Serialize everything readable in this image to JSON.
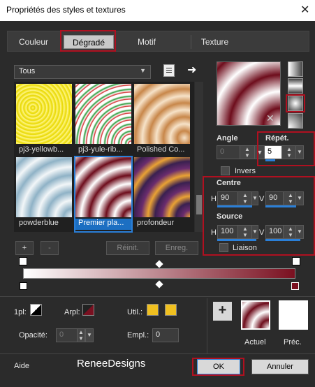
{
  "window": {
    "title": "Propriétés des styles et textures",
    "close": "✕"
  },
  "tabs": [
    {
      "label": "Couleur"
    },
    {
      "label": "Dégradé",
      "active": true
    },
    {
      "label": "Motif"
    },
    {
      "label": "Texture"
    }
  ],
  "gallery": {
    "category": "Tous",
    "items": [
      {
        "label": "pj3-yellowb..."
      },
      {
        "label": "pj3-yule-rib..."
      },
      {
        "label": "Polished Co..."
      },
      {
        "label": "powderblue"
      },
      {
        "label": "Premier pla...",
        "selected": true
      },
      {
        "label": "profondeur"
      }
    ],
    "add_label": "+",
    "remove_label": "-",
    "reset_label": "Réinit.",
    "save_label": "Enreg."
  },
  "params": {
    "angle_label": "Angle",
    "angle_value": "0",
    "repeat_label": "Répét.",
    "repeat_value": "5",
    "invert_label": "Invers",
    "center_label": "Centre",
    "center_h_label": "H",
    "center_h": "90",
    "center_v_label": "V",
    "center_v": "90",
    "source_label": "Source",
    "source_h_label": "H",
    "source_h": "100",
    "source_v_label": "V",
    "source_v": "100",
    "link_label": "Liaison"
  },
  "bottom": {
    "opacity_label": "Opacité:",
    "opacity_value": "0",
    "pl1_label": "1pl:",
    "arpl_label": "Arpl:",
    "util_label": "Util.:",
    "empl_label": "Empl.:",
    "empl_value": "0",
    "current_label": "Actuel",
    "previous_label": "Préc.",
    "plus": "+"
  },
  "footer": {
    "help": "Aide",
    "watermark": "ReneeDesigns",
    "ok": "OK",
    "cancel": "Annuler"
  },
  "colors": {
    "accent": "#2a7fd8",
    "highlight": "#b01020",
    "wine": "#7a1020",
    "swatch": "#f0c020"
  }
}
